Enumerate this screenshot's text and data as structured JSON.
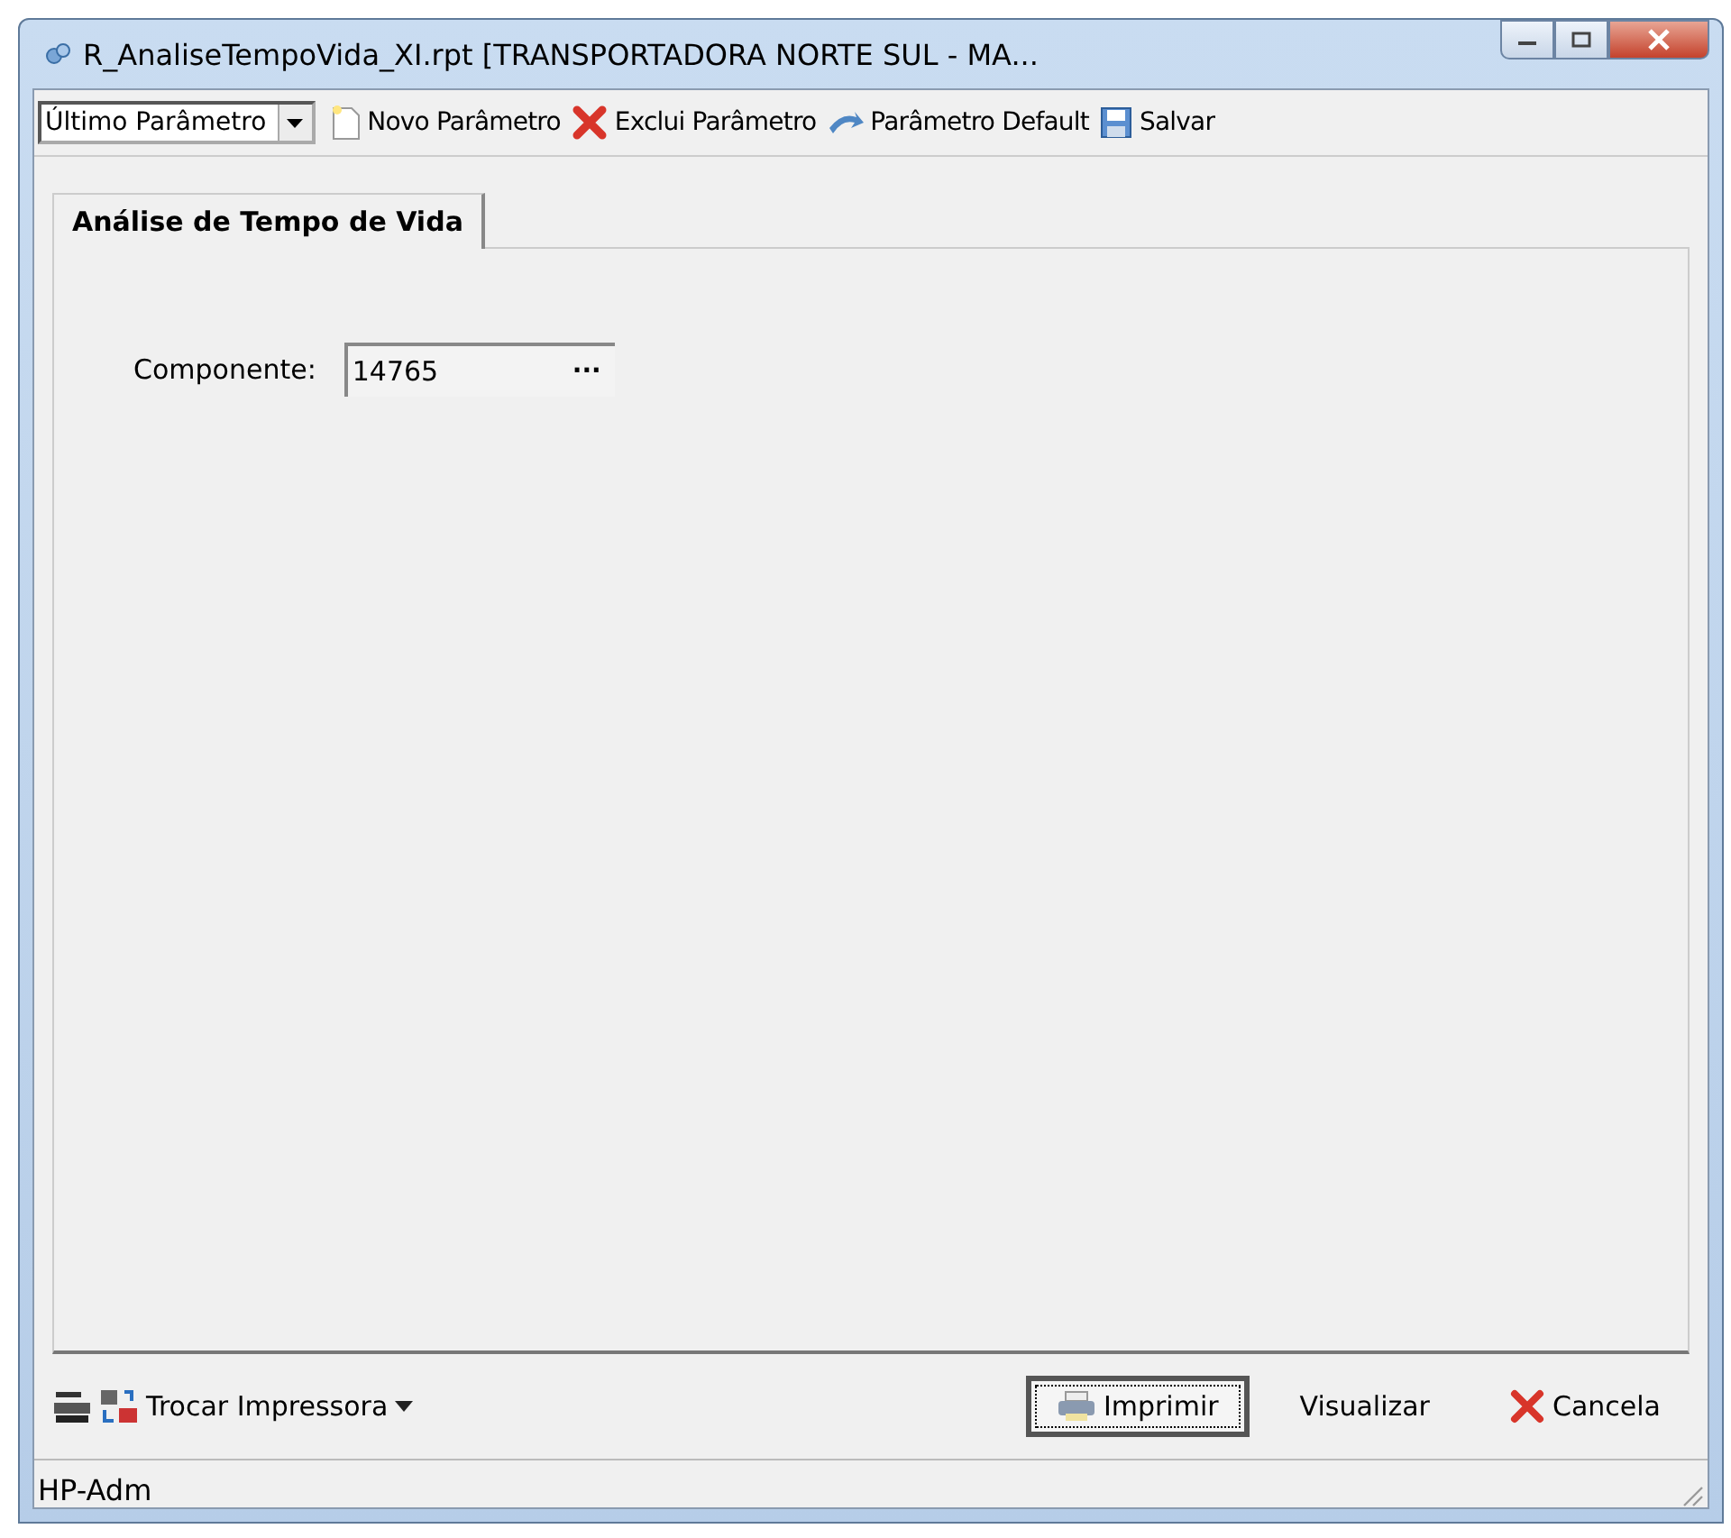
{
  "window": {
    "title": "R_AnaliseTempoVida_XI.rpt [TRANSPORTADORA NORTE SUL -  MA..."
  },
  "toolbar": {
    "parameter_select": {
      "value": "Último Parâmetro"
    },
    "buttons": [
      {
        "kind": "new",
        "label": "Novo Parâmetro"
      },
      {
        "kind": "delete",
        "label": "Exclui Parâmetro"
      },
      {
        "kind": "default",
        "label": "Parâmetro Default"
      },
      {
        "kind": "save",
        "label": "Salvar"
      }
    ]
  },
  "tabs": [
    {
      "label": "Análise de Tempo de Vida",
      "selected": true
    }
  ],
  "form": {
    "label": "Componente:",
    "value": "14765",
    "browse": "···"
  },
  "footer": {
    "printer_button": {
      "label": "Trocar Impressora"
    },
    "buttons": [
      {
        "kind": "print",
        "label": "Imprimir",
        "focused": true
      },
      {
        "kind": "preview",
        "label": "Visualizar",
        "focused": false
      },
      {
        "kind": "cancel",
        "label": "Cancela",
        "focused": false
      }
    ]
  },
  "status_bar": {
    "text": "HP-Adm"
  }
}
